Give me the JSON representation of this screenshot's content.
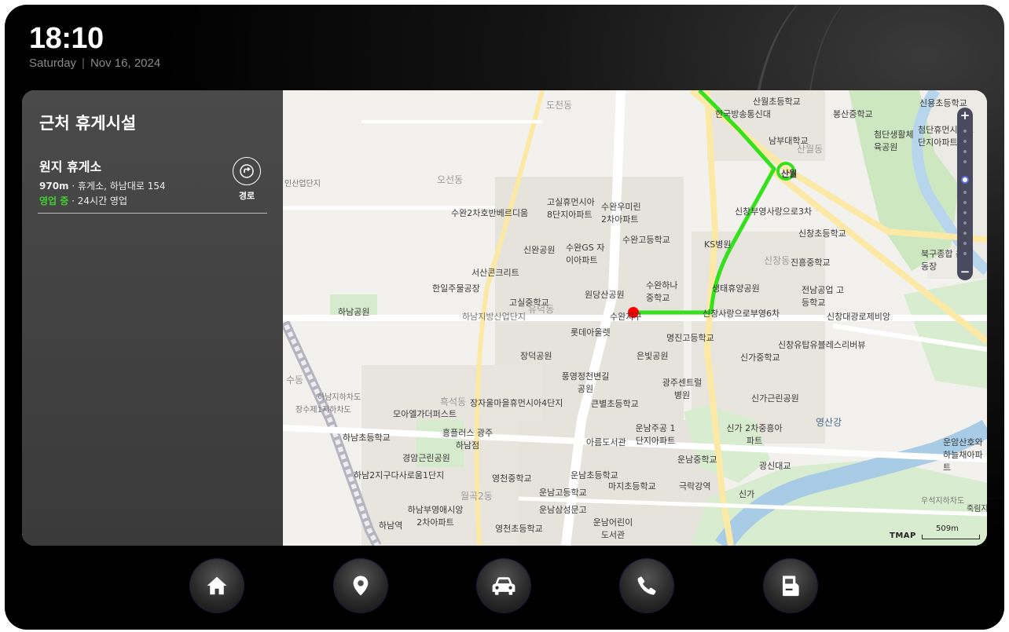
{
  "status_bar": {
    "time": "18:10",
    "day": "Saturday",
    "date": "Nov 16, 2024"
  },
  "side_panel": {
    "title": "근처 휴게시설",
    "facility": {
      "name": "원지 휴게소",
      "distance": "970m",
      "details": "휴게소, 하남대로 154",
      "status": "영업 중",
      "hours": "24시간 영업",
      "route_label": "경로"
    }
  },
  "map": {
    "attribution": "TMAP",
    "scale": "509m",
    "labels": {
      "l1": "도천동",
      "l2": "오선동",
      "l3": "산월초등학교",
      "l4": "한국방송통신대",
      "l5": "봉산중학교",
      "l6": "남부대학교",
      "l7": "산월동",
      "l8": "산월",
      "l9": "첨단생활체육공원",
      "l10": "첨단휴먼시아 1단지아파트",
      "l11": "신용초등학교",
      "l12": "고실휴먼시아 8단지아파트",
      "l13": "수완우미린 2차아파트",
      "l14": "수완2차호반베르디움",
      "l15": "신창부영사랑으로3차",
      "l16": "신완공원",
      "l17": "수완GS 자이아파트",
      "l18": "수완고등학교",
      "l19": "KS병원",
      "l20": "신창초등학교",
      "l21": "진흥중학교",
      "l22": "북구종합 운동장",
      "l23": "서산콘크리트",
      "l24": "한일주물공장",
      "l25": "원당산공원",
      "l26": "수완하나 중학교",
      "l27": "생태휴양공원",
      "l28": "전남공업 고등학교",
      "l29": "고실중학교",
      "l30": "하남지방산업단지",
      "l31": "하남공원",
      "l32": "롯데아울렛",
      "l33": "수완지구",
      "l34": "신창사랑으로부영6차",
      "l35": "신창대광로제비앙",
      "l36": "명진고등학교",
      "l37": "신창유탑유블레스리버뷰",
      "l38": "장덕공원",
      "l39": "은빛공원",
      "l40": "신가중학교",
      "l41": "풍영정천변길 공원",
      "l42": "광주센트럴 병원",
      "l43": "하남지하차도",
      "l44": "장수제1지하차도",
      "l45": "장자울마을휴먼시아4단지",
      "l46": "큰별초등학교",
      "l47": "신가근린공원",
      "l48": "모아엘가더퍼스트",
      "l49": "영산강",
      "l50": "흥플러스 광주하남점",
      "l51": "운남주공 1단지아파트",
      "l52": "신가 2차중흥아파트",
      "l53": "하남초등학교",
      "l54": "아름도서관",
      "l55": "경암근린공원",
      "l56": "운남중학교",
      "l57": "광신대교",
      "l58": "운암산호와 하늘채아파트",
      "l59": "하남2지구다사로움1단지",
      "l60": "영천중학교",
      "l61": "운남초등학교",
      "l62": "마지초등학교",
      "l63": "극락강역",
      "l64": "신가",
      "l65": "운남고등학교",
      "l66": "월곡2동",
      "l67": "우석지하차도",
      "l68": "하남부영애시앙 2차아파트",
      "l69": "운남삼성문고",
      "l70": "운남어린이 도서관",
      "l71": "하남역",
      "l72": "영천초등학교",
      "l73": "인산업단지",
      "l74": "수동",
      "l75": "흑석동",
      "l76": "유덕동",
      "l77": "신창동",
      "l78": "죽림지"
    }
  },
  "dock": {
    "home": "home-icon",
    "location": "location-pin-icon",
    "car": "car-icon",
    "phone": "phone-icon",
    "fuel": "fuel-icon"
  },
  "colors": {
    "route": "#35e01c",
    "current_position": "#ff0000",
    "open_status": "#3ed22e"
  }
}
